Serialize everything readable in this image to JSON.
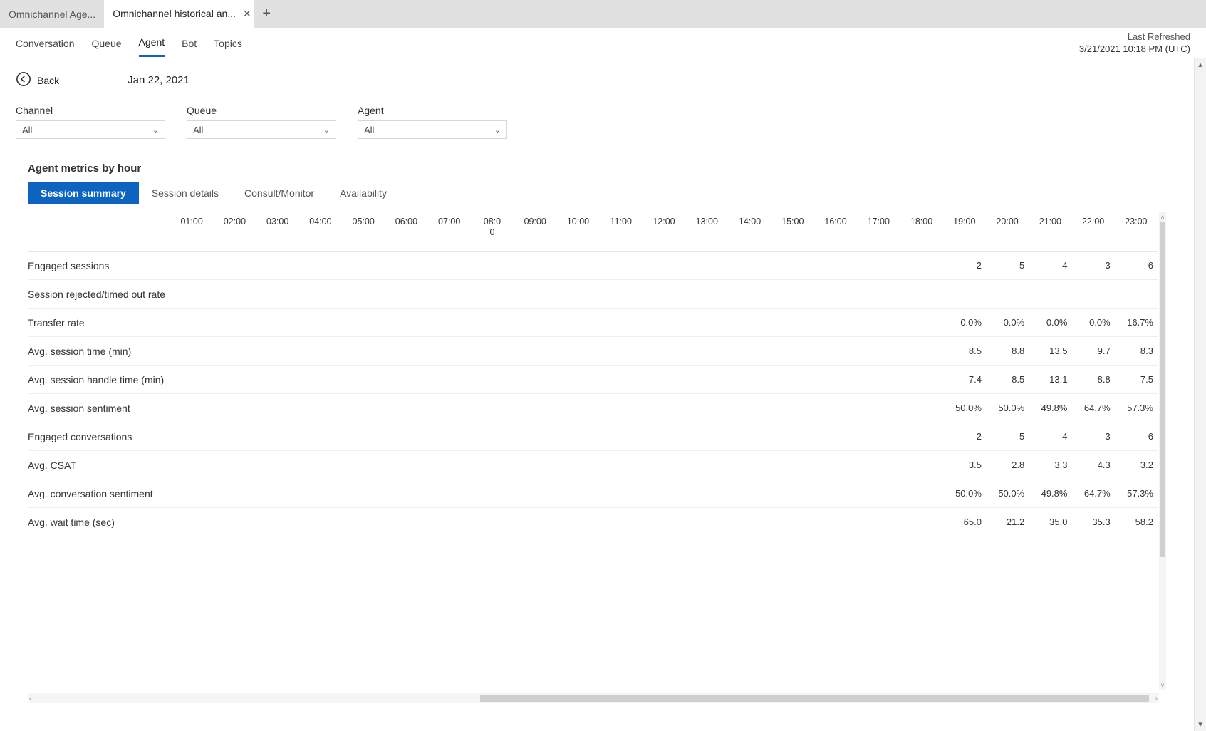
{
  "tabs": {
    "items": [
      {
        "label": "Omnichannel Age...",
        "active": false,
        "closable": false
      },
      {
        "label": "Omnichannel historical an...",
        "active": true,
        "closable": true
      }
    ],
    "newtab_title": "+"
  },
  "nav": {
    "items": [
      "Conversation",
      "Queue",
      "Agent",
      "Bot",
      "Topics"
    ],
    "active_index": 2
  },
  "refresh": {
    "label": "Last Refreshed",
    "value": "3/21/2021 10:18 PM (UTC)"
  },
  "back": {
    "label": "Back",
    "date": "Jan 22, 2021"
  },
  "filters": {
    "channel": {
      "label": "Channel",
      "value": "All"
    },
    "queue": {
      "label": "Queue",
      "value": "All"
    },
    "agent": {
      "label": "Agent",
      "value": "All"
    }
  },
  "card": {
    "title": "Agent metrics by hour",
    "segments": [
      "Session summary",
      "Session details",
      "Consult/Monitor",
      "Availability"
    ],
    "active_segment_index": 0
  },
  "hours": [
    "01:00",
    "02:00",
    "03:00",
    "04:00",
    "05:00",
    "06:00",
    "07:00",
    "08:00",
    "09:00",
    "10:00",
    "11:00",
    "12:00",
    "13:00",
    "14:00",
    "15:00",
    "16:00",
    "17:00",
    "18:00",
    "19:00",
    "20:00",
    "21:00",
    "22:00",
    "23:00"
  ],
  "rows": [
    {
      "label": "Engaged sessions",
      "values": {
        "19:00": "2",
        "20:00": "5",
        "21:00": "4",
        "22:00": "3",
        "23:00": "6"
      }
    },
    {
      "label": "Session rejected/timed out rate",
      "values": {}
    },
    {
      "label": "Transfer rate",
      "values": {
        "19:00": "0.0%",
        "20:00": "0.0%",
        "21:00": "0.0%",
        "22:00": "0.0%",
        "23:00": "16.7%"
      }
    },
    {
      "label": "Avg. session time (min)",
      "values": {
        "19:00": "8.5",
        "20:00": "8.8",
        "21:00": "13.5",
        "22:00": "9.7",
        "23:00": "8.3"
      }
    },
    {
      "label": "Avg. session handle time (min)",
      "values": {
        "19:00": "7.4",
        "20:00": "8.5",
        "21:00": "13.1",
        "22:00": "8.8",
        "23:00": "7.5"
      }
    },
    {
      "label": "Avg. session sentiment",
      "values": {
        "19:00": "50.0%",
        "20:00": "50.0%",
        "21:00": "49.8%",
        "22:00": "64.7%",
        "23:00": "57.3%"
      }
    },
    {
      "label": "Engaged conversations",
      "values": {
        "19:00": "2",
        "20:00": "5",
        "21:00": "4",
        "22:00": "3",
        "23:00": "6"
      }
    },
    {
      "label": "Avg. CSAT",
      "values": {
        "19:00": "3.5",
        "20:00": "2.8",
        "21:00": "3.3",
        "22:00": "4.3",
        "23:00": "3.2"
      }
    },
    {
      "label": "Avg. conversation sentiment",
      "values": {
        "19:00": "50.0%",
        "20:00": "50.0%",
        "21:00": "49.8%",
        "22:00": "64.7%",
        "23:00": "57.3%"
      }
    },
    {
      "label": "Avg. wait time (sec)",
      "values": {
        "19:00": "65.0",
        "20:00": "21.2",
        "21:00": "35.0",
        "22:00": "35.3",
        "23:00": "58.2"
      }
    }
  ],
  "chart_data": {
    "type": "table",
    "title": "Agent metrics by hour — Session summary — Jan 22, 2021",
    "x": [
      "01:00",
      "02:00",
      "03:00",
      "04:00",
      "05:00",
      "06:00",
      "07:00",
      "08:00",
      "09:00",
      "10:00",
      "11:00",
      "12:00",
      "13:00",
      "14:00",
      "15:00",
      "16:00",
      "17:00",
      "18:00",
      "19:00",
      "20:00",
      "21:00",
      "22:00",
      "23:00"
    ],
    "series": [
      {
        "name": "Engaged sessions",
        "unit": "count",
        "values": [
          null,
          null,
          null,
          null,
          null,
          null,
          null,
          null,
          null,
          null,
          null,
          null,
          null,
          null,
          null,
          null,
          null,
          null,
          2,
          5,
          4,
          3,
          6
        ]
      },
      {
        "name": "Session rejected/timed out rate",
        "unit": "%",
        "values": [
          null,
          null,
          null,
          null,
          null,
          null,
          null,
          null,
          null,
          null,
          null,
          null,
          null,
          null,
          null,
          null,
          null,
          null,
          null,
          null,
          null,
          null,
          null
        ]
      },
      {
        "name": "Transfer rate",
        "unit": "%",
        "values": [
          null,
          null,
          null,
          null,
          null,
          null,
          null,
          null,
          null,
          null,
          null,
          null,
          null,
          null,
          null,
          null,
          null,
          null,
          0.0,
          0.0,
          0.0,
          0.0,
          16.7
        ]
      },
      {
        "name": "Avg. session time (min)",
        "unit": "min",
        "values": [
          null,
          null,
          null,
          null,
          null,
          null,
          null,
          null,
          null,
          null,
          null,
          null,
          null,
          null,
          null,
          null,
          null,
          null,
          8.5,
          8.8,
          13.5,
          9.7,
          8.3
        ]
      },
      {
        "name": "Avg. session handle time (min)",
        "unit": "min",
        "values": [
          null,
          null,
          null,
          null,
          null,
          null,
          null,
          null,
          null,
          null,
          null,
          null,
          null,
          null,
          null,
          null,
          null,
          null,
          7.4,
          8.5,
          13.1,
          8.8,
          7.5
        ]
      },
      {
        "name": "Avg. session sentiment",
        "unit": "%",
        "values": [
          null,
          null,
          null,
          null,
          null,
          null,
          null,
          null,
          null,
          null,
          null,
          null,
          null,
          null,
          null,
          null,
          null,
          null,
          50.0,
          50.0,
          49.8,
          64.7,
          57.3
        ]
      },
      {
        "name": "Engaged conversations",
        "unit": "count",
        "values": [
          null,
          null,
          null,
          null,
          null,
          null,
          null,
          null,
          null,
          null,
          null,
          null,
          null,
          null,
          null,
          null,
          null,
          null,
          2,
          5,
          4,
          3,
          6
        ]
      },
      {
        "name": "Avg. CSAT",
        "unit": "score",
        "values": [
          null,
          null,
          null,
          null,
          null,
          null,
          null,
          null,
          null,
          null,
          null,
          null,
          null,
          null,
          null,
          null,
          null,
          null,
          3.5,
          2.8,
          3.3,
          4.3,
          3.2
        ]
      },
      {
        "name": "Avg. conversation sentiment",
        "unit": "%",
        "values": [
          null,
          null,
          null,
          null,
          null,
          null,
          null,
          null,
          null,
          null,
          null,
          null,
          null,
          null,
          null,
          null,
          null,
          null,
          50.0,
          50.0,
          49.8,
          64.7,
          57.3
        ]
      },
      {
        "name": "Avg. wait time (sec)",
        "unit": "sec",
        "values": [
          null,
          null,
          null,
          null,
          null,
          null,
          null,
          null,
          null,
          null,
          null,
          null,
          null,
          null,
          null,
          null,
          null,
          null,
          65.0,
          21.2,
          35.0,
          35.3,
          58.2
        ]
      }
    ]
  }
}
